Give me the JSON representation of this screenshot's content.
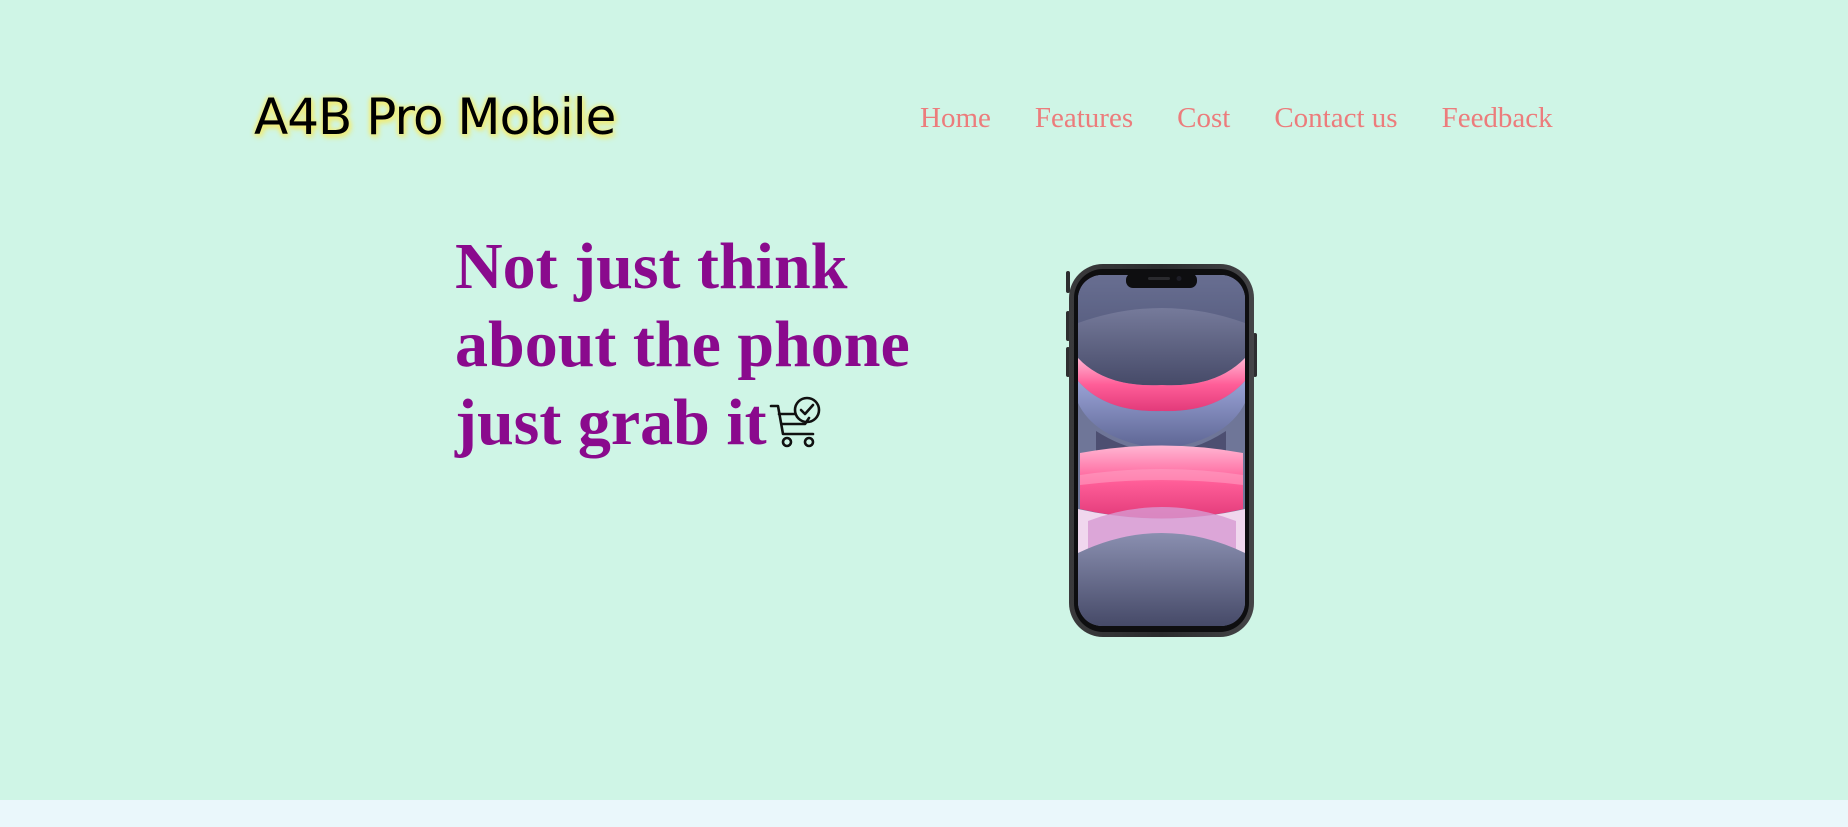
{
  "brand": {
    "title": "A4B Pro Mobile"
  },
  "nav": {
    "items": [
      {
        "label": "Home"
      },
      {
        "label": "Features"
      },
      {
        "label": "Cost"
      },
      {
        "label": "Contact us"
      },
      {
        "label": "Feedback"
      }
    ]
  },
  "hero": {
    "headline_lines": [
      "Not just think",
      "about the phone",
      "just grab it"
    ],
    "cart_icon": "shopping-cart-check-icon",
    "image": "smartphone-image"
  },
  "colors": {
    "hero_background": "#cff5e6",
    "page_background": "#eaf7fb",
    "nav_link": "#ec7c7c",
    "headline": "#8a0a8d",
    "brand_glow": "#f4ef7a"
  }
}
